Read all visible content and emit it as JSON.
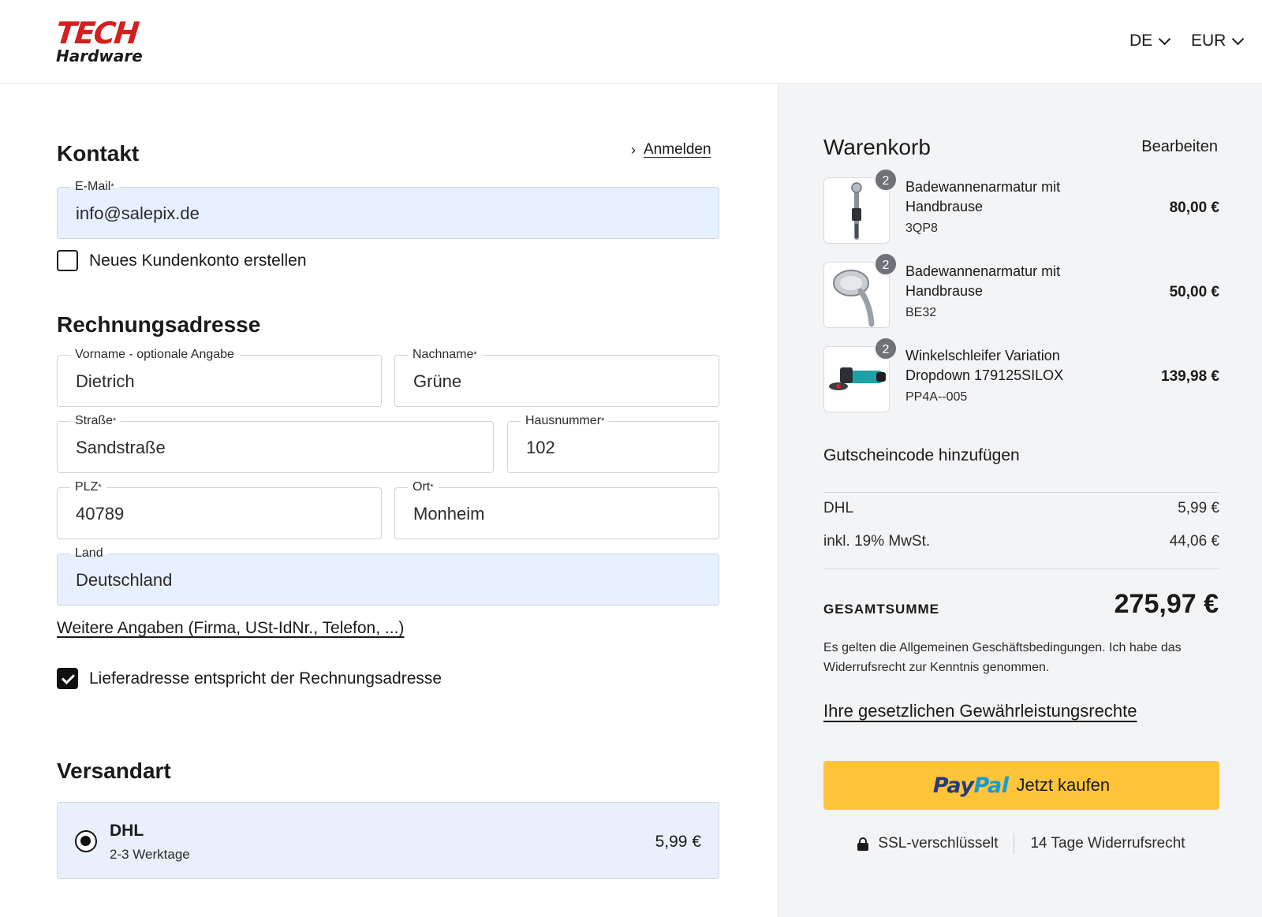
{
  "header": {
    "logo_line1": "TECH",
    "logo_line2": "Hardware",
    "language": "DE",
    "currency": "EUR"
  },
  "contact": {
    "title": "Kontakt",
    "login_link": "Anmelden",
    "email_label": "E-Mail",
    "email_value": "info@salepix.de",
    "create_account_label": "Neues Kundenkonto erstellen",
    "create_account_checked": false
  },
  "billing": {
    "title": "Rechnungsadresse",
    "firstname_label": "Vorname - optionale Angabe",
    "firstname_value": "Dietrich",
    "lastname_label": "Nachname",
    "lastname_value": "Grüne",
    "street_label": "Straße",
    "street_value": "Sandstraße",
    "housenumber_label": "Hausnummer",
    "housenumber_value": "102",
    "zip_label": "PLZ",
    "zip_value": "40789",
    "city_label": "Ort",
    "city_value": "Monheim",
    "country_label": "Land",
    "country_value": "Deutschland",
    "more_details_link": "Weitere Angaben (Firma, USt-IdNr., Telefon, ...)",
    "same_address_label": "Lieferadresse entspricht der Rechnungsadresse",
    "same_address_checked": true
  },
  "shipping": {
    "title": "Versandart",
    "method_name": "DHL",
    "method_time": "2-3 Werktage",
    "method_price": "5,99 €"
  },
  "cart": {
    "title": "Warenkorb",
    "edit_link": "Bearbeiten",
    "items": [
      {
        "qty": "2",
        "name": "Badewannenarmatur mit Handbrause",
        "sku": "3QP8",
        "price": "80,00 €"
      },
      {
        "qty": "2",
        "name": "Badewannenarmatur mit Handbrause",
        "sku": "BE32",
        "price": "50,00 €"
      },
      {
        "qty": "2",
        "name": "Winkelschleifer Variation Dropdown 179125SILOX",
        "sku": "PP4A--005",
        "price": "139,98 €"
      }
    ],
    "coupon_link": "Gutscheincode hinzufügen",
    "shipping_label": "DHL",
    "shipping_value": "5,99 €",
    "tax_label": "inkl. 19% MwSt.",
    "tax_value": "44,06 €",
    "total_label": "GESAMTSUMME",
    "total_value": "275,97 €",
    "legal_text": "Es gelten die Allgemeinen Geschäftsbedingungen. Ich habe das Widerrufsrecht zur Kenntnis genommen.",
    "warranty_link": "Ihre gesetzlichen Gewährleistungsrechte",
    "paypal_logo_1": "Pay",
    "paypal_logo_2": "Pal",
    "paypal_button_text": "Jetzt kaufen",
    "trust_ssl": "SSL-verschlüsselt",
    "trust_return": "14 Tage Widerrufsrecht"
  },
  "colors": {
    "brand_red": "#d3201f",
    "autofill_blue": "#e7f0fe",
    "paypal_yellow": "#ffc439",
    "sidebar_bg": "#f3f4f6"
  }
}
